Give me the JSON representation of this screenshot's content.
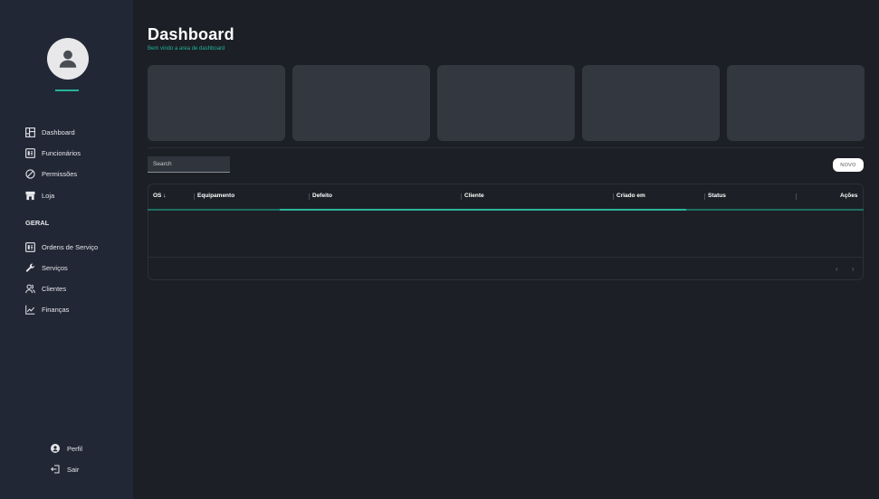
{
  "sidebar": {
    "items": [
      {
        "label": "Dashboard",
        "icon": "dashboard-icon"
      },
      {
        "label": "Funcionários",
        "icon": "id-card-icon"
      },
      {
        "label": "Permissões",
        "icon": "block-icon"
      },
      {
        "label": "Loja",
        "icon": "store-icon"
      }
    ],
    "section_title": "GERAL",
    "geral_items": [
      {
        "label": "Ordens de Serviço",
        "icon": "id-card-icon"
      },
      {
        "label": "Serviços",
        "icon": "wrench-icon"
      },
      {
        "label": "Clientes",
        "icon": "people-icon"
      },
      {
        "label": "Finanças",
        "icon": "chart-line-icon"
      }
    ],
    "profile_label": "Perfil",
    "logout_label": "Sair"
  },
  "header": {
    "title": "Dashboard",
    "subtitle": "Bem vindo a area de dashboard"
  },
  "toolbar": {
    "search_placeholder": "Search",
    "new_label": "NOVO"
  },
  "table": {
    "columns": [
      "OS ↓",
      "Equipamento",
      "Defeito",
      "Cliente",
      "Criado em",
      "Status",
      "Ações"
    ]
  },
  "pagination": {
    "prev": "‹",
    "next": "›"
  },
  "colors": {
    "accent": "#26b39a",
    "sidebar_bg": "#212735",
    "main_bg": "#1c1f25",
    "card_bg": "#333740"
  }
}
